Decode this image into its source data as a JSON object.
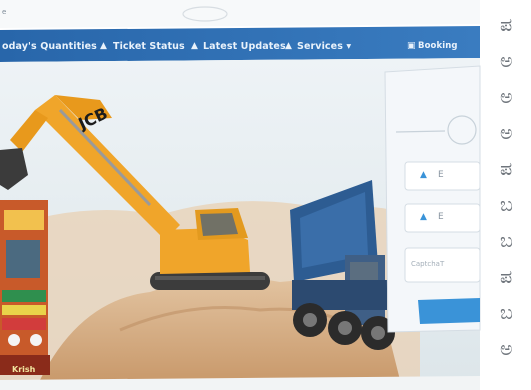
{
  "screen": {
    "top_left_text": "e",
    "nav": {
      "todays_quantities": "oday's Quantities",
      "ticket_status": "Ticket Status",
      "latest_updates": "Latest Updates",
      "services": "Services ▾",
      "bookings": "Booking"
    },
    "login_panel": {
      "field_1_fragment": "E",
      "field_2_fragment": "E",
      "captcha_placeholder": "CaptchaT"
    },
    "truck_plate": "Krish"
  },
  "side_text": [
    "ಪ",
    "ಅ",
    "ಅ",
    "ಅ",
    "ಪ",
    "ಬ",
    "ಬ",
    "ಪ",
    "ಬ",
    "ಅ"
  ],
  "colors": {
    "nav_bar": "#2c6fb3",
    "sand": "#d9b38a",
    "excavator": "#f0a52a",
    "truck_blue": "#2d5c92",
    "panel": "#f4f7fa",
    "accent_blue": "#3a93d8"
  },
  "icons": [
    "user-icon",
    "bell-icon",
    "lock-icon",
    "booking-icon"
  ]
}
